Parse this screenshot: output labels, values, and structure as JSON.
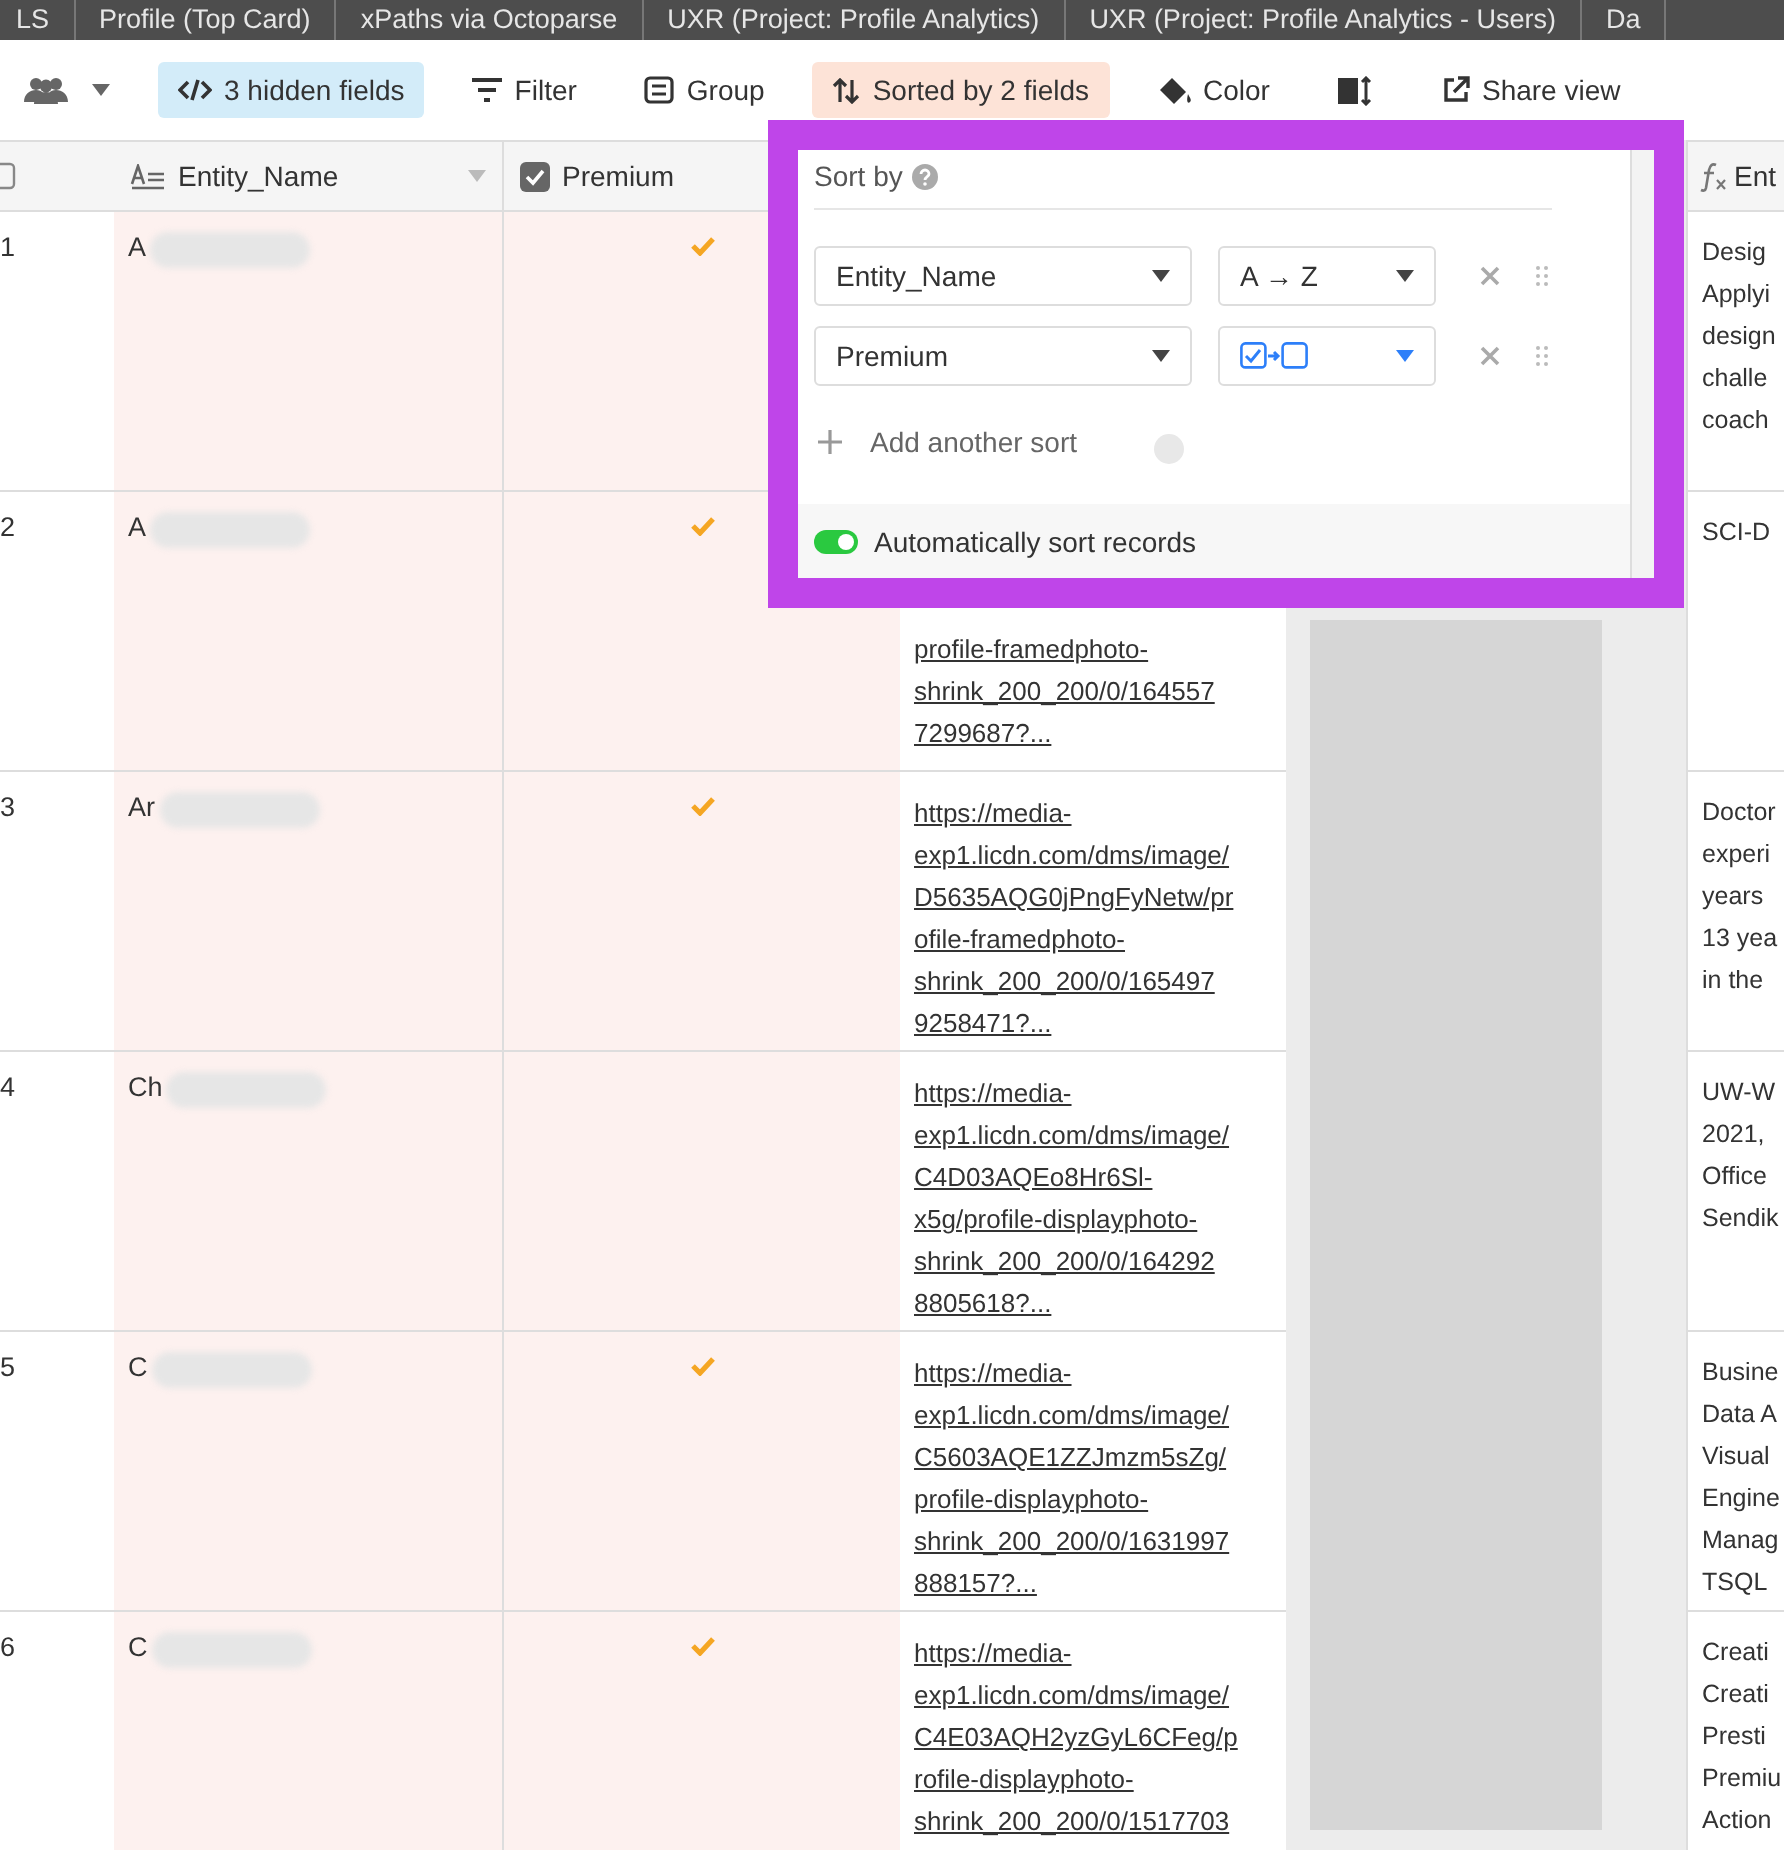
{
  "top_tabs": [
    {
      "label": "LS"
    },
    {
      "label": "Profile (Top Card)"
    },
    {
      "label": "xPaths via Octoparse"
    },
    {
      "label": "UXR (Project: Profile Analytics)"
    },
    {
      "label": "UXR (Project: Profile Analytics - Users)"
    },
    {
      "label": "Da"
    }
  ],
  "toolbar": [
    {
      "kind": "people"
    },
    {
      "kind": "hidden",
      "label": "3 hidden fields",
      "color": "#d3ecf9"
    },
    {
      "kind": "filter",
      "label": "Filter"
    },
    {
      "kind": "group",
      "label": "Group"
    },
    {
      "kind": "sort",
      "label": "Sorted by 2 fields",
      "color": "#fde3d7"
    },
    {
      "kind": "color",
      "label": "Color"
    },
    {
      "kind": "row_height"
    },
    {
      "kind": "share",
      "label": "Share view"
    }
  ],
  "select_all": {
    "checked": false
  },
  "columns": [
    {
      "kind": "text",
      "name": "Entity_Name"
    },
    {
      "kind": "checkbox",
      "name": "Premium"
    },
    {
      "kind": "formula",
      "name": "Ent"
    }
  ],
  "rows": [
    {
      "number": "1",
      "name": "A",
      "premium": true,
      "summary_lines": [
        "Desig",
        "Applyi",
        "design",
        "challe",
        "coach"
      ]
    },
    {
      "number": "2",
      "name": "A",
      "premium": true,
      "url_lines": [
        "profile-framedphoto-",
        "shrink_200_200/0/164557",
        "7299687?..."
      ],
      "summary_lines": [
        "SCI-D"
      ]
    },
    {
      "number": "3",
      "name": "Ar",
      "premium": true,
      "url_lines": [
        "https://media-",
        "exp1.licdn.com/dms/image/",
        "D5635AQG0jPngFyNetw/pr",
        "ofile-framedphoto-",
        "shrink_200_200/0/165497",
        "9258471?..."
      ],
      "summary_lines": [
        "Doctor",
        "experi",
        "years",
        "13 yea",
        "in the"
      ]
    },
    {
      "number": "4",
      "name": "Ch",
      "premium": false,
      "url_lines": [
        "https://media-",
        "exp1.licdn.com/dms/image/",
        "C4D03AQEo8Hr6Sl-",
        "x5g/profile-displayphoto-",
        "shrink_200_200/0/164292",
        "8805618?..."
      ],
      "summary_lines": [
        "UW-W",
        "2021,",
        "Office",
        "Sendik"
      ]
    },
    {
      "number": "5",
      "name": "C",
      "premium": true,
      "url_lines": [
        "https://media-",
        "exp1.licdn.com/dms/image/",
        "C5603AQE1ZZJmzm5sZg/",
        "profile-displayphoto-",
        "shrink_200_200/0/1631997",
        "888157?..."
      ],
      "summary_lines": [
        "Busine",
        "Data A",
        "Visual",
        "Engine",
        "Manag",
        "TSQL"
      ]
    },
    {
      "number": "6",
      "name": "C",
      "premium": true,
      "url_lines": [
        "https://media-",
        "exp1.licdn.com/dms/image/",
        "C4E03AQH2yzGyL6CFeg/p",
        "rofile-displayphoto-",
        "shrink_200_200/0/1517703"
      ],
      "summary_lines": [
        "Creati",
        "Creati",
        "Presti",
        "Premiu",
        "Action"
      ]
    }
  ],
  "sort_popup": {
    "title": "Sort by",
    "sorts": [
      {
        "field": "Entity_Name",
        "kind": "text",
        "direction": "A → Z"
      },
      {
        "field": "Premium",
        "kind": "checkbox_order"
      }
    ],
    "add_label": "Add another sort",
    "auto_sort": {
      "label": "Automatically sort records",
      "on": true
    }
  }
}
